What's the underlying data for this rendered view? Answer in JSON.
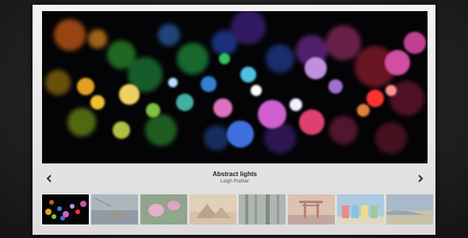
{
  "slider": {
    "title": "Abstract lights",
    "author": "Leigh Prather",
    "prev_icon": "chevron-left-icon",
    "next_icon": "chevron-right-icon"
  },
  "thumbnails": [
    {
      "name": "abstract-lights",
      "active": true
    },
    {
      "name": "boat-on-lake",
      "active": false
    },
    {
      "name": "lotus-flowers",
      "active": false
    },
    {
      "name": "pyramids",
      "active": false
    },
    {
      "name": "bamboo",
      "active": false
    },
    {
      "name": "torii-gate",
      "active": false
    },
    {
      "name": "beach-huts",
      "active": false
    },
    {
      "name": "shoreline",
      "active": false
    }
  ],
  "colors": {
    "frame": "#e8e8e8",
    "background": "#222222",
    "title": "#222222"
  }
}
